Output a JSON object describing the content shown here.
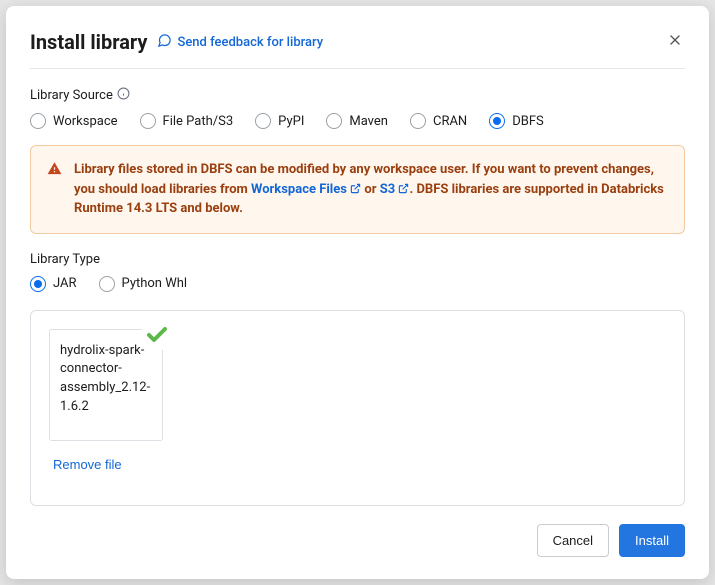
{
  "dialog": {
    "title": "Install library",
    "feedback_label": "Send feedback for library"
  },
  "librarySource": {
    "label": "Library Source",
    "options": [
      "Workspace",
      "File Path/S3",
      "PyPI",
      "Maven",
      "CRAN",
      "DBFS"
    ],
    "selected": "DBFS"
  },
  "warning": {
    "text_bold_1": "Library files stored in DBFS can be modified by any workspace user. If you want to prevent changes, you should load libraries from ",
    "link1": "Workspace Files",
    "connector": " or ",
    "link2": "S3",
    "text_bold_2": ". DBFS libraries are supported in Databricks Runtime 14.3 LTS and below."
  },
  "libraryType": {
    "label": "Library Type",
    "options": [
      "JAR",
      "Python Whl"
    ],
    "selected": "JAR"
  },
  "uploaded": {
    "filename": "hydrolix-spark-connector-assembly_2.12-1.6.2",
    "remove_label": "Remove file"
  },
  "footer": {
    "cancel": "Cancel",
    "install": "Install"
  }
}
